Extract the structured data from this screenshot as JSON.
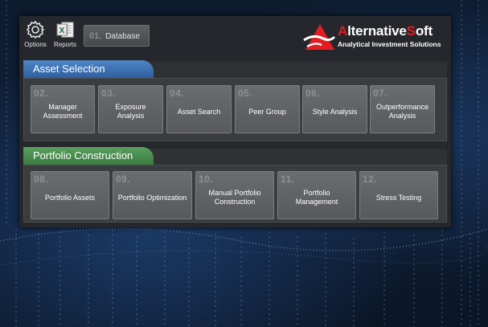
{
  "toolbar": {
    "options_label": "Options",
    "reports_label": "Reports",
    "database": {
      "number": "01.",
      "label": "Database"
    }
  },
  "brand": {
    "name_red_1": "A",
    "name_white_1": "lternative",
    "name_red_2": "S",
    "name_white_2": "oft",
    "tagline": "Analytical Investment Solutions",
    "colors": {
      "red": "#e11d22",
      "white": "#ffffff"
    }
  },
  "sections": {
    "asset_selection": {
      "title": "Asset Selection",
      "color": "#3b6fb0",
      "tiles": [
        {
          "number": "02.",
          "label": "Manager Assessment"
        },
        {
          "number": "03.",
          "label": "Exposure Analysis"
        },
        {
          "number": "04.",
          "label": "Asset Search"
        },
        {
          "number": "05.",
          "label": "Peer Group"
        },
        {
          "number": "06.",
          "label": "Style Analysis"
        },
        {
          "number": "07.",
          "label": "Outperformance Analysis"
        }
      ]
    },
    "portfolio_construction": {
      "title": "Portfolio Construction",
      "color": "#4a8c4e",
      "tiles": [
        {
          "number": "08.",
          "label": "Portfolio Assets"
        },
        {
          "number": "09.",
          "label": "Portfolio Optimization"
        },
        {
          "number": "10.",
          "label": "Manual Portfolio Construction"
        },
        {
          "number": "11.",
          "label": "Portfolio Management"
        },
        {
          "number": "12.",
          "label": "Stress Testing"
        }
      ]
    }
  }
}
